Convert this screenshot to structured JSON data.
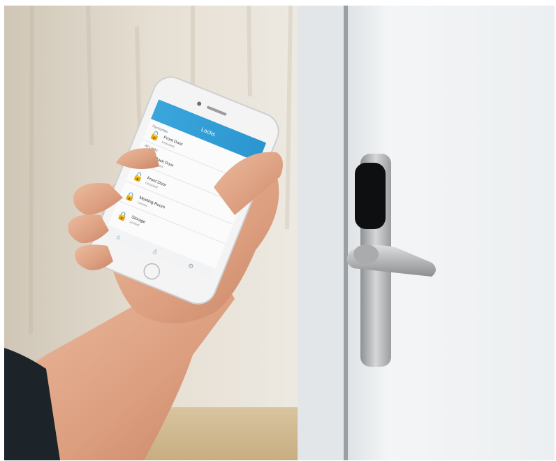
{
  "scene": {
    "subject": "hand holding smartphone in front of a door with an electronic lock handle"
  },
  "phone_app": {
    "header_title": "Locks",
    "section_favourites": "Favourites",
    "section_all": "All Locks",
    "locks": [
      {
        "name": "Front Door",
        "status": "Unlocked"
      },
      {
        "name": "Back Door",
        "status": "Locked"
      },
      {
        "name": "Front Door",
        "status": "Unlocked"
      },
      {
        "name": "Meeting Room",
        "status": "Locked"
      },
      {
        "name": "Storage",
        "status": "Locked"
      }
    ],
    "tab_icons": [
      "home-icon",
      "person-icon",
      "settings-icon"
    ]
  },
  "colors": {
    "app_header": "#2f9fd8",
    "wall": "#e4ddd2",
    "door": "#f0f2f4",
    "skin": "#e2a98c",
    "sleeve": "#1c242a",
    "handle": "#b7b9bb"
  }
}
